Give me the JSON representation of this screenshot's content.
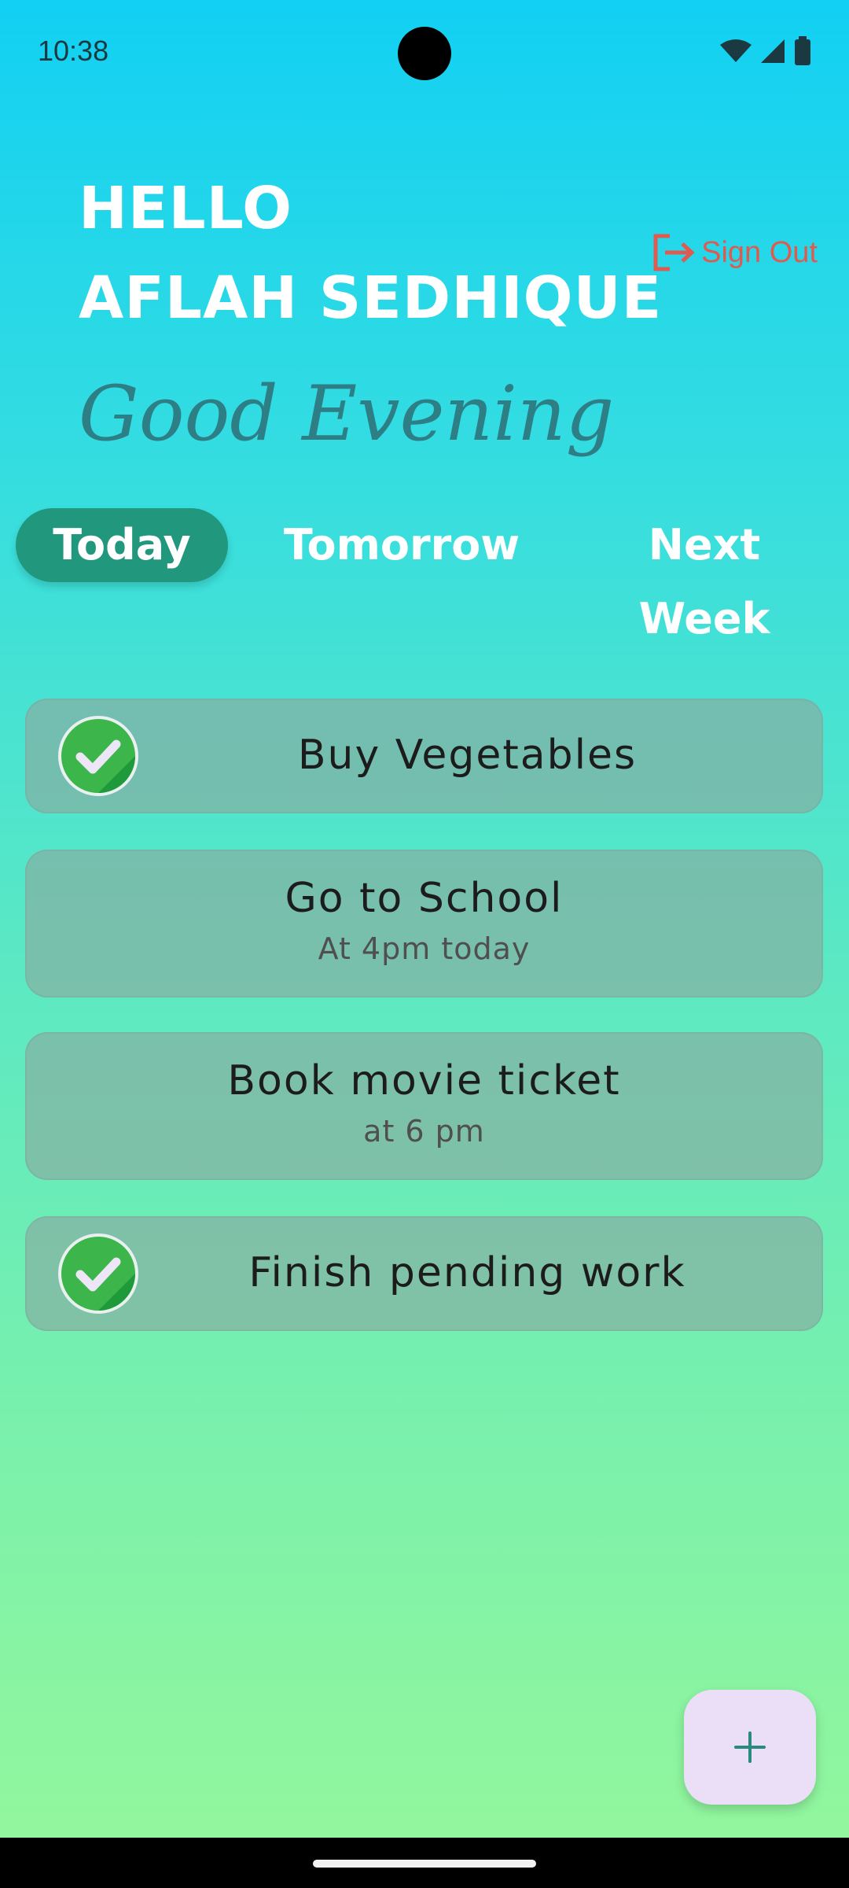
{
  "status": {
    "time": "10:38"
  },
  "header": {
    "hello": "HELLO",
    "name": "AFLAH SEDHIQUE",
    "greeting": "Good Evening",
    "sign_out": "Sign Out"
  },
  "tabs": [
    {
      "label": "Today",
      "active": true
    },
    {
      "label": "Tomorrow",
      "active": false
    },
    {
      "label": "Next Week",
      "active": false
    }
  ],
  "tasks": [
    {
      "title": "Buy Vegetables",
      "subtitle": "",
      "done": true
    },
    {
      "title": "Go to School",
      "subtitle": "At 4pm today",
      "done": false
    },
    {
      "title": "Book movie ticket",
      "subtitle": "at 6 pm",
      "done": false
    },
    {
      "title": "Finish pending work",
      "subtitle": "",
      "done": true
    }
  ],
  "fab": {
    "icon": "plus-icon",
    "label": "+"
  },
  "colors": {
    "accent": "#21977e",
    "sign_out": "#e05a4f",
    "check_green": "#3cb54a"
  }
}
